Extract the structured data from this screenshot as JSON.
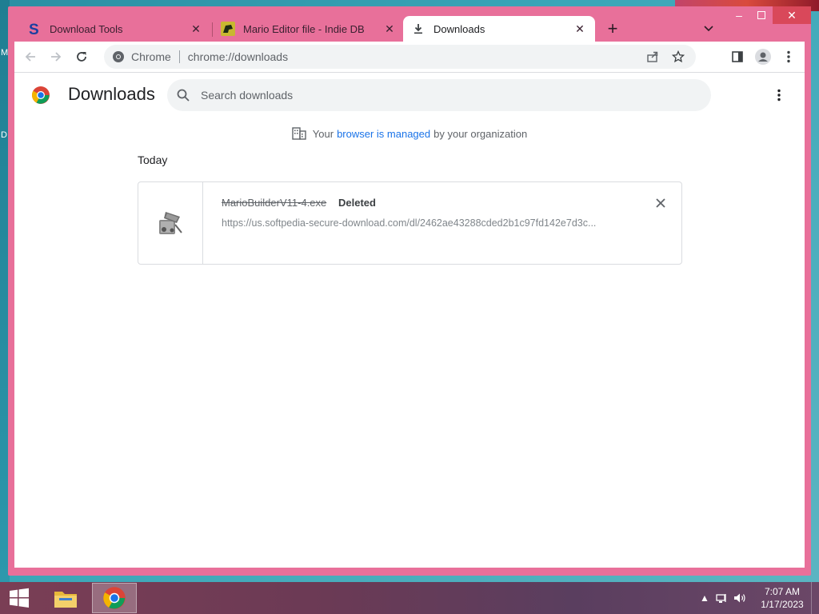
{
  "desktop": {
    "left_labels": [
      "M",
      "D"
    ]
  },
  "tabs": [
    {
      "title": "Download Tools",
      "icon": "softpedia-s-icon",
      "active": false
    },
    {
      "title": "Mario Editor file - Indie DB",
      "icon": "indiedb-icon",
      "active": false
    },
    {
      "title": "Downloads",
      "icon": "download-icon",
      "active": true
    }
  ],
  "toolbar": {
    "omnibox_chip": "Chrome",
    "omnibox_url": "chrome://downloads"
  },
  "page": {
    "title": "Downloads",
    "search_placeholder": "Search downloads",
    "managed_prefix": "Your",
    "managed_link": "browser is managed",
    "managed_suffix": "by your organization",
    "section_label": "Today"
  },
  "downloads": [
    {
      "filename": "MarioBuilderV11-4.exe",
      "status": "Deleted",
      "url": "https://us.softpedia-secure-download.com/dl/2462ae43288cded2b1c97fd142e7d3c..."
    }
  ],
  "taskbar": {
    "time": "7:07 AM",
    "date": "1/17/2023"
  },
  "colors": {
    "window_frame": "#e8709a",
    "link": "#1a73e8",
    "close_button": "#d9485a"
  }
}
